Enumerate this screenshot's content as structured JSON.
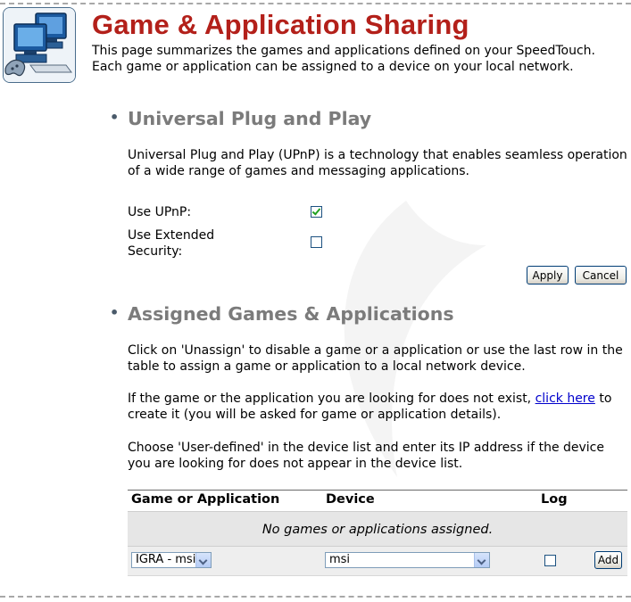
{
  "header": {
    "title": "Game & Application Sharing",
    "intro": "This page summarizes the games and applications defined on your SpeedTouch. Each game or application can be assigned to a device on your local network."
  },
  "upnp_section": {
    "heading": "Universal Plug and Play",
    "description": "Universal Plug and Play (UPnP) is a technology that enables seamless operation of a wide range of games and messaging applications.",
    "use_upnp_label": "Use UPnP:",
    "use_upnp_checked": true,
    "extended_security_label": "Use Extended Security:",
    "extended_security_checked": false,
    "apply_label": "Apply",
    "cancel_label": "Cancel"
  },
  "assigned_section": {
    "heading": "Assigned Games & Applications",
    "para1": "Click on 'Unassign' to disable a game or a application or use the last row in the table to assign a game or application to a local network device.",
    "para2_before": "If the game or the application you are looking for does not exist, ",
    "para2_link": "click here",
    "para2_after": " to create it (you will be asked for game or application details).",
    "para3": "Choose 'User-defined' in the device list and enter its IP address if the device you are looking for does not appear in the device list."
  },
  "table": {
    "headers": [
      "Game or Application",
      "Device",
      "Log"
    ],
    "empty_message": "No games or applications assigned.",
    "add_row": {
      "game_selected": "IGRA - msi",
      "device_selected": "msi",
      "log_checked": false,
      "add_label": "Add"
    }
  },
  "colors": {
    "title": "#b3201a",
    "section_heading": "#7b7b7b",
    "link": "#0000cc",
    "checkmark": "#21a121"
  },
  "icons": [
    "computer-network-logo-icon",
    "checkbox-icon",
    "dropdown-arrow-icon"
  ]
}
